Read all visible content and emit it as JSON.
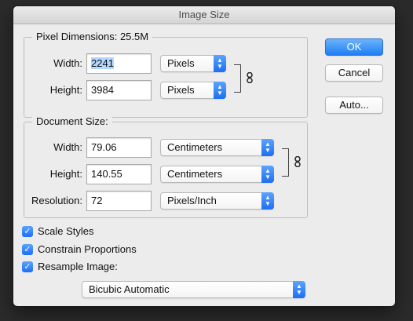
{
  "window": {
    "title": "Image Size"
  },
  "pixel_dimensions": {
    "label": "Pixel Dimensions:",
    "size": "25.5M",
    "width": {
      "label": "Width:",
      "value": "2241",
      "unit": "Pixels"
    },
    "height": {
      "label": "Height:",
      "value": "3984",
      "unit": "Pixels"
    }
  },
  "document_size": {
    "label": "Document Size:",
    "width": {
      "label": "Width:",
      "value": "79.06",
      "unit": "Centimeters"
    },
    "height": {
      "label": "Height:",
      "value": "140.55",
      "unit": "Centimeters"
    },
    "resolution": {
      "label": "Resolution:",
      "value": "72",
      "unit": "Pixels/Inch"
    }
  },
  "options": {
    "scale_styles": {
      "label": "Scale Styles",
      "checked": true
    },
    "constrain_proportions": {
      "label": "Constrain Proportions",
      "checked": true
    },
    "resample_image": {
      "label": "Resample Image:",
      "checked": true
    }
  },
  "resample_method": "Bicubic Automatic",
  "buttons": {
    "ok": "OK",
    "cancel": "Cancel",
    "auto": "Auto..."
  },
  "colors": {
    "accent": "#1f7ef5",
    "dialog_bg": "#ececec",
    "selection": "#b3d7ff"
  }
}
